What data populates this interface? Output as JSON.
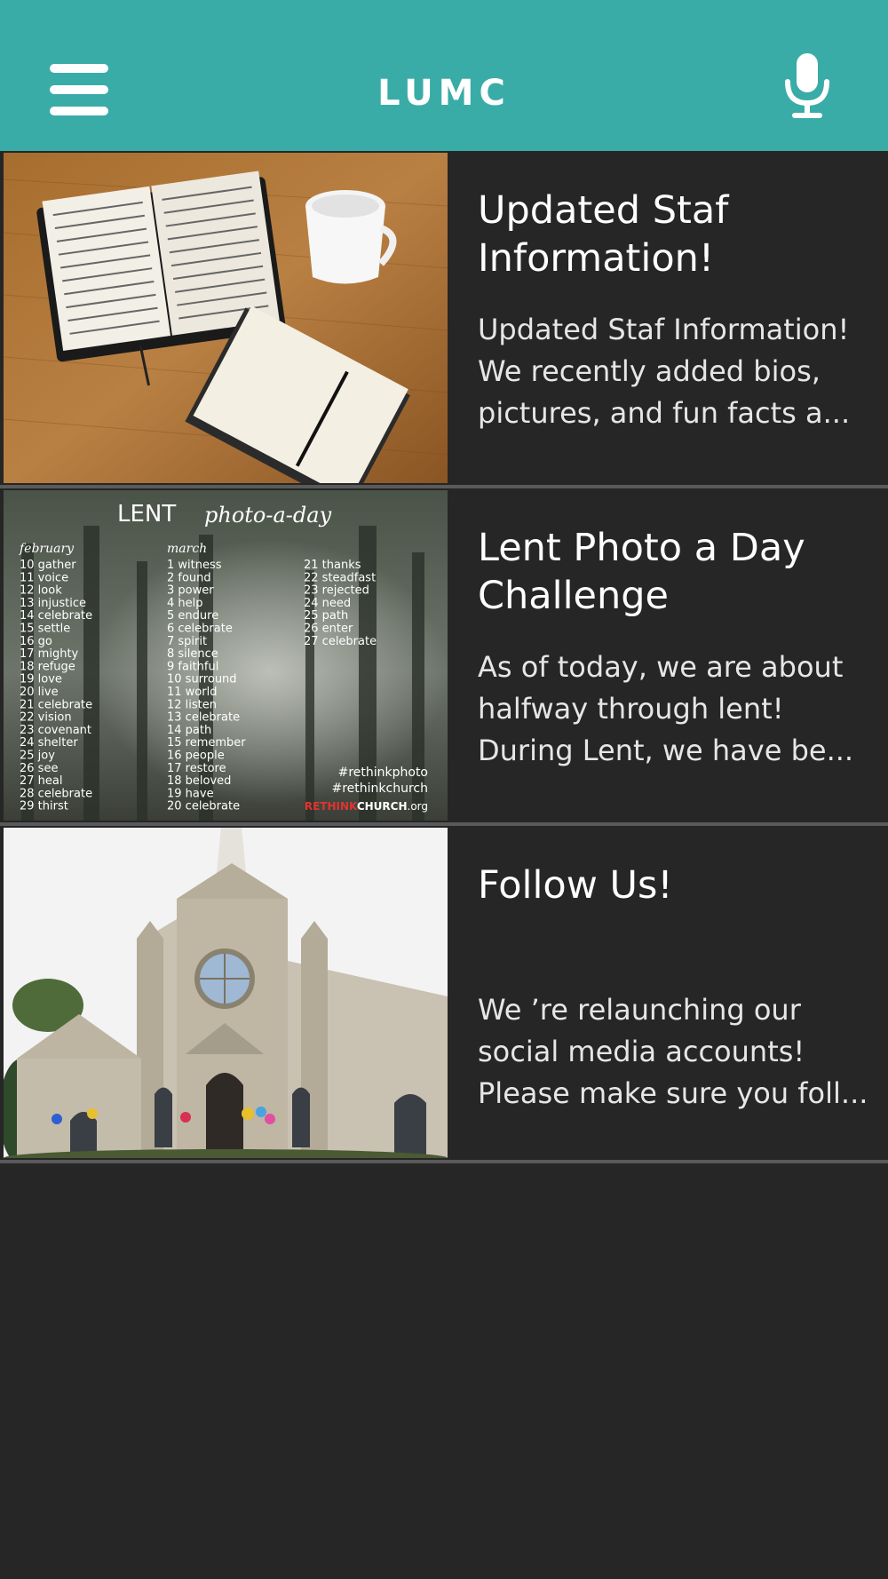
{
  "header": {
    "title": "LUMC",
    "menu_icon": "hamburger-menu-icon",
    "mic_icon": "microphone-icon",
    "background": "#3aaca7"
  },
  "feed": {
    "items": [
      {
        "title_line1": "Updated Staf",
        "title_line2": "Information!",
        "excerpt_line1": "Updated Staf  Information!",
        "excerpt_line2": "We recently added bios,",
        "excerpt_line3": "pictures, and fun facts a...",
        "image": "bible-and-notebook-photo"
      },
      {
        "title_line1": "Lent Photo a Day",
        "title_line2": "Challenge",
        "excerpt_line1": "As of today, we are about",
        "excerpt_line2": "halfway through lent!",
        "excerpt_line3": "During Lent, we have be...",
        "image": "lent-photo-a-day-calendar",
        "poster": {
          "title": "LENT",
          "subtitle": "photo-a-day",
          "col1_header": "february",
          "col2_header": "march",
          "col1": [
            "10  gather",
            "11  voice",
            "12  look",
            "13  injustice",
            "14  celebrate",
            "15  settle",
            "16  go",
            "17  mighty",
            "18  refuge",
            "19  love",
            "20  live",
            "21  celebrate",
            "22  vision",
            "23  covenant",
            "24  shelter",
            "25  joy",
            "26  see",
            "27  heal",
            "28  celebrate",
            "29  thirst"
          ],
          "col2": [
            "1  witness",
            "2  found",
            "3  power",
            "4  help",
            "5  endure",
            "6  celebrate",
            "7  spirit",
            "8  silence",
            "9  faithful",
            "10  surround",
            "11  world",
            "12  listen",
            "13  celebrate",
            "14  path",
            "15  remember",
            "16  people",
            "17  restore",
            "18  beloved",
            "19  have",
            "20  celebrate"
          ],
          "col3": [
            "21  thanks",
            "22  steadfast",
            "23  rejected",
            "24  need",
            "25  path",
            "26  enter",
            "27  celebrate"
          ],
          "hashtag1": "#rethinkphoto",
          "hashtag2": "#rethinkchurch",
          "brand_red": "RETHINK",
          "brand_white": "CHURCH",
          "brand_suffix": ".org"
        }
      },
      {
        "title_line1": "Follow Us!",
        "title_line2": "",
        "excerpt_line1": "We ’re relaunching our",
        "excerpt_line2": "social media accounts!",
        "excerpt_line3": "Please make sure you foll...",
        "image": "church-building-photo"
      }
    ]
  }
}
